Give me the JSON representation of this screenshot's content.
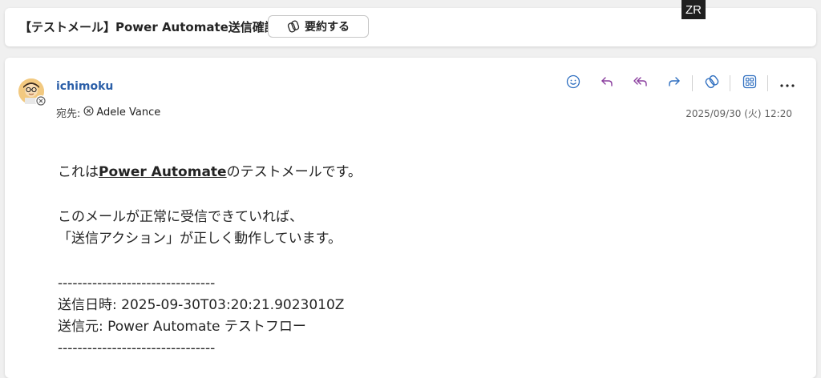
{
  "subject": {
    "title": "【テストメール】Power Automate送信確認",
    "summarize_label": "要約する"
  },
  "overlay": {
    "badge": "ZR"
  },
  "message": {
    "sender": "ichimoku",
    "to_label": "宛先:",
    "recipient": "Adele Vance",
    "date": "2025/09/30 (火) 12:20",
    "toolbar": {
      "icons": [
        "smiley-icon",
        "reply-icon",
        "reply-all-icon",
        "forward-icon",
        "copilot-icon",
        "apps-icon",
        "more-icon"
      ]
    },
    "body": {
      "line1_prefix": "これは",
      "line1_bold": "Power Automate",
      "line1_suffix": "のテストメールです。",
      "line2": "このメールが正常に受信できていれば、",
      "line3": "「送信アクション」が正しく動作しています。",
      "separator": "--------------------------------",
      "sent_time": "送信日時: 2025-09-30T03:20:21.9023010Z",
      "sender_info": "送信元: Power Automate テストフロー",
      "separator_end": "--------------------------------"
    }
  },
  "colors": {
    "accent_blue": "#2b5fa8",
    "icon_purple": "#8a3e9e",
    "icon_blue": "#2f6fc0"
  }
}
